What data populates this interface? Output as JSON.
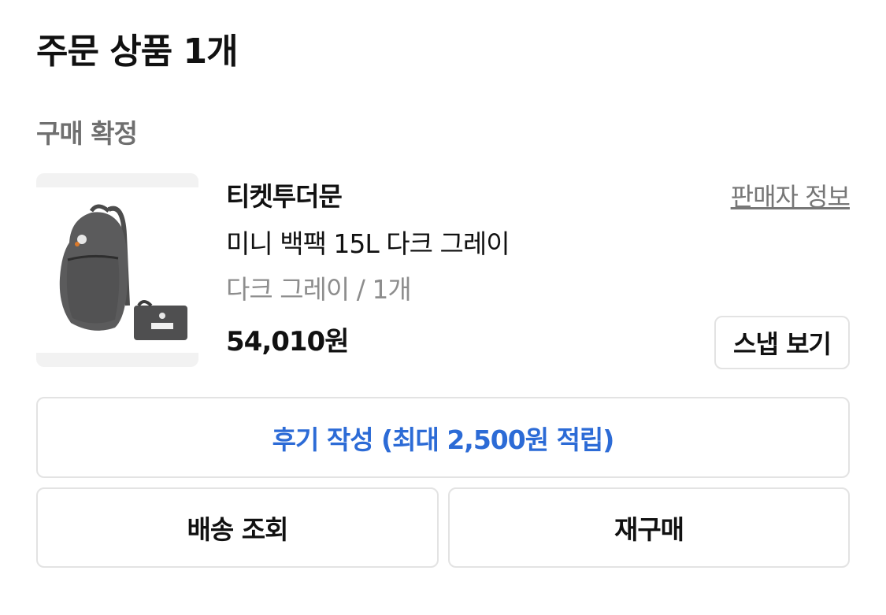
{
  "order": {
    "title": "주문 상품 1개",
    "status": "구매 확정"
  },
  "product": {
    "seller": "티켓투더문",
    "seller_info_label": "판매자 정보",
    "name": "미니 백팩 15L 다크 그레이",
    "option": "다크 그레이 / 1개",
    "price": "54,010원",
    "image_icon": "backpack-image",
    "snap_label": "스냅 보기"
  },
  "actions": {
    "review_label": "후기 작성 (최대 2,500원 적립)",
    "delivery_label": "배송 조회",
    "rebuy_label": "재구매"
  },
  "colors": {
    "accent_blue": "#2c6bd6",
    "border": "#e3e3e3",
    "muted_text": "#8d8d8d"
  }
}
